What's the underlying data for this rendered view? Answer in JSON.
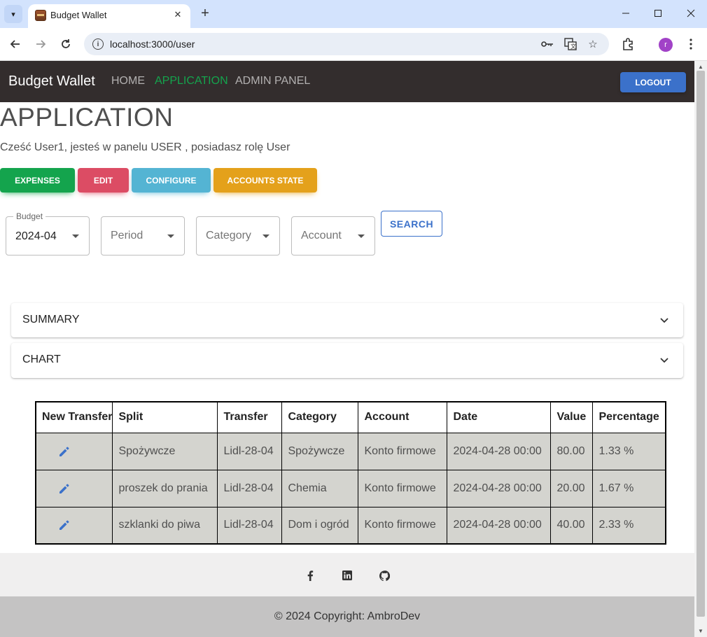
{
  "browser": {
    "tab_title": "Budget Wallet",
    "url": "localhost:3000/user",
    "profile_initial": "r"
  },
  "navbar": {
    "brand": "Budget Wallet",
    "links": [
      {
        "label": "HOME",
        "active": false
      },
      {
        "label": "APPLICATION",
        "active": true
      },
      {
        "label": "ADMIN PANEL",
        "active": false
      }
    ],
    "logout_label": "LOGOUT"
  },
  "page": {
    "title": "APPLICATION",
    "greeting": "Cześć User1, jesteś w panelu USER , posiadasz rolę User"
  },
  "actions": [
    {
      "label": "EXPENSES",
      "color": "#14a44d"
    },
    {
      "label": "EDIT",
      "color": "#dc4c64"
    },
    {
      "label": "CONFIGURE",
      "color": "#54b4d3"
    },
    {
      "label": "ACCOUNTS STATE",
      "color": "#e4a11b"
    }
  ],
  "filters": {
    "budget": {
      "legend": "Budget",
      "value": "2024-04"
    },
    "period": {
      "placeholder": "Period"
    },
    "category": {
      "placeholder": "Category"
    },
    "account": {
      "placeholder": "Account"
    },
    "search_label": "SEARCH"
  },
  "accordions": [
    {
      "label": "SUMMARY"
    },
    {
      "label": "CHART"
    }
  ],
  "table": {
    "headers": [
      "New Transfer",
      "Split",
      "Transfer",
      "Category",
      "Account",
      "Date",
      "Value",
      "Percentage"
    ],
    "rows": [
      {
        "split": "Spożywcze",
        "transfer": "Lidl-28-04",
        "category": "Spożywcze",
        "account": "Konto firmowe",
        "date": "2024-04-28 00:00",
        "value": "80.00",
        "percentage": "1.33 %"
      },
      {
        "split": "proszek do prania",
        "transfer": "Lidl-28-04",
        "category": "Chemia",
        "account": "Konto firmowe",
        "date": "2024-04-28 00:00",
        "value": "20.00",
        "percentage": "1.67 %"
      },
      {
        "split": "szklanki do piwa",
        "transfer": "Lidl-28-04",
        "category": "Dom i ogród",
        "account": "Konto firmowe",
        "date": "2024-04-28 00:00",
        "value": "40.00",
        "percentage": "2.33 %"
      }
    ]
  },
  "footer": {
    "social": [
      "facebook-icon",
      "linkedin-icon",
      "github-icon"
    ],
    "copyright": "© 2024 Copyright: AmbroDev"
  },
  "colors": {
    "navbar_bg": "#332d2d",
    "primary": "#3b71ca",
    "success": "#14a44d",
    "row_bg": "#d4d4cf"
  }
}
